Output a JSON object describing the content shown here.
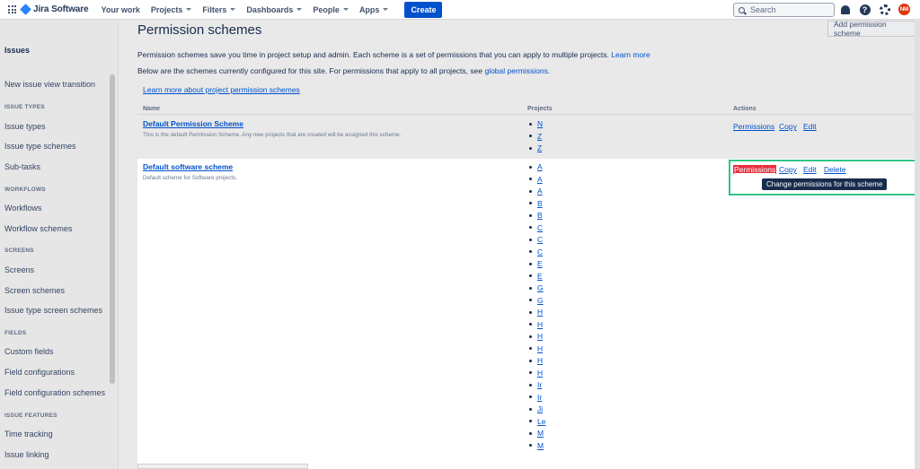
{
  "topbar": {
    "logo_text": "Jira Software",
    "nav": [
      {
        "label": "Your work",
        "caret": false
      },
      {
        "label": "Projects",
        "caret": true
      },
      {
        "label": "Filters",
        "caret": true
      },
      {
        "label": "Dashboards",
        "caret": true
      },
      {
        "label": "People",
        "caret": true
      },
      {
        "label": "Apps",
        "caret": true
      }
    ],
    "create_label": "Create",
    "search_placeholder": "Search",
    "help_glyph": "?",
    "avatar_initials": "NM"
  },
  "sidebar": {
    "title": "Issues",
    "items": [
      {
        "type": "link",
        "label": "New issue view transition"
      },
      {
        "type": "head",
        "label": "ISSUE TYPES"
      },
      {
        "type": "link",
        "label": "Issue types"
      },
      {
        "type": "link",
        "label": "Issue type schemes"
      },
      {
        "type": "link",
        "label": "Sub-tasks"
      },
      {
        "type": "head",
        "label": "WORKFLOWS"
      },
      {
        "type": "link",
        "label": "Workflows"
      },
      {
        "type": "link",
        "label": "Workflow schemes"
      },
      {
        "type": "head",
        "label": "SCREENS"
      },
      {
        "type": "link",
        "label": "Screens"
      },
      {
        "type": "link",
        "label": "Screen schemes"
      },
      {
        "type": "link",
        "label": "Issue type screen schemes"
      },
      {
        "type": "head",
        "label": "FIELDS"
      },
      {
        "type": "link",
        "label": "Custom fields"
      },
      {
        "type": "link",
        "label": "Field configurations"
      },
      {
        "type": "link",
        "label": "Field configuration schemes"
      },
      {
        "type": "head",
        "label": "ISSUE FEATURES"
      },
      {
        "type": "link",
        "label": "Time tracking"
      },
      {
        "type": "link",
        "label": "Issue linking"
      }
    ]
  },
  "main": {
    "title": "Permission schemes",
    "add_button": "Add permission scheme",
    "intro_text": "Permission schemes save you time in project setup and admin. Each scheme is a set of permissions that you can apply to multiple projects.",
    "intro_link": "Learn more",
    "below_text": "Below are the schemes currently configured for this site. For permissions that apply to all projects, see",
    "below_link": "global permissions",
    "below_end": ".",
    "learn_more_schemes": "Learn more about project permission schemes",
    "columns": {
      "name": "Name",
      "projects": "Projects",
      "actions": "Actions"
    },
    "schemes": [
      {
        "name": "Default Permission Scheme",
        "description": "This is the default Permission Scheme. Any new projects that are created will be assigned this scheme.",
        "projects": [
          "N",
          "Z",
          "Z"
        ],
        "actions": [
          "Permissions",
          "Copy",
          "Edit"
        ]
      },
      {
        "name": "Default software scheme",
        "description": "Default scheme for Software projects.",
        "projects": [
          "A",
          "A",
          "A",
          "B",
          "B",
          "C",
          "C",
          "C",
          "E",
          "E",
          "G",
          "G",
          "H",
          "H",
          "H",
          "H",
          "H",
          "H",
          "Ir",
          "Ir",
          "Ji",
          "Le",
          "M",
          "M"
        ],
        "actions": [
          "Permissions",
          "Copy",
          "Edit",
          "Delete"
        ]
      }
    ],
    "tooltip": "Change permissions for this scheme"
  }
}
